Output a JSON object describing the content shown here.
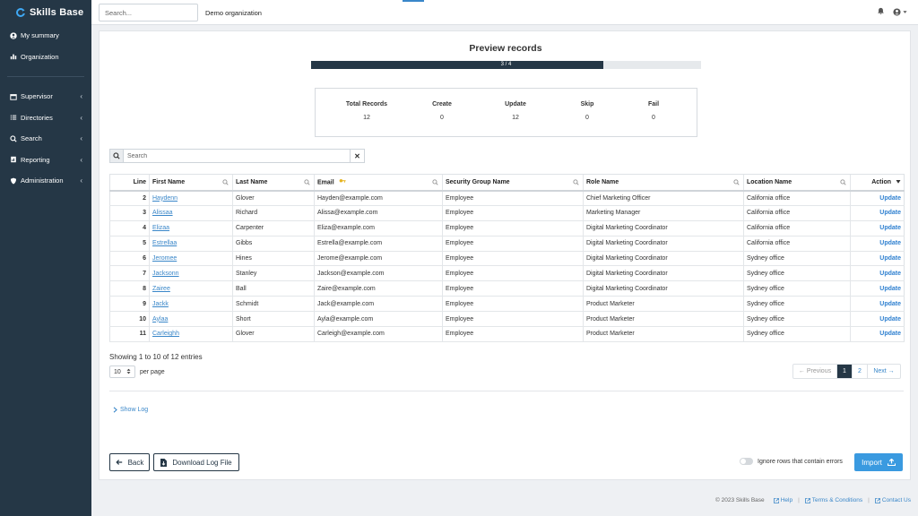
{
  "app": {
    "name": "Skills Base"
  },
  "sidebar": {
    "items": [
      {
        "label": "My summary",
        "icon": "user-circle-icon",
        "chevron": false
      },
      {
        "label": "Organization",
        "icon": "bar-chart-icon",
        "chevron": false
      }
    ],
    "sections": [
      {
        "label": "Supervisor",
        "icon": "calendar-icon"
      },
      {
        "label": "Directories",
        "icon": "list-icon"
      },
      {
        "label": "Search",
        "icon": "search-icon"
      },
      {
        "label": "Reporting",
        "icon": "report-icon"
      },
      {
        "label": "Administration",
        "icon": "shield-icon"
      }
    ]
  },
  "topbar": {
    "search_placeholder": "Search...",
    "org": "Demo organization"
  },
  "preview": {
    "title": "Preview records",
    "progress": {
      "text": "3 / 4",
      "fraction": 0.75
    },
    "stats": [
      {
        "label": "Total Records",
        "value": "12"
      },
      {
        "label": "Create",
        "value": "0"
      },
      {
        "label": "Update",
        "value": "12"
      },
      {
        "label": "Skip",
        "value": "0"
      },
      {
        "label": "Fail",
        "value": "0"
      }
    ]
  },
  "table": {
    "search_placeholder": "Search",
    "clear_label": "✕",
    "columns": [
      "Line",
      "First Name",
      "Last Name",
      "Email",
      "Security Group Name",
      "Role Name",
      "Location Name",
      "Action"
    ],
    "rows": [
      [
        "2",
        "Haydenn",
        "Glover",
        "Hayden@example.com",
        "Employee",
        "Chief Marketing Officer",
        "California office",
        "Update"
      ],
      [
        "3",
        "Alissaa",
        "Richard",
        "Alissa@example.com",
        "Employee",
        "Marketing Manager",
        "California office",
        "Update"
      ],
      [
        "4",
        "Elizaa",
        "Carpenter",
        "Eliza@example.com",
        "Employee",
        "Digital Marketing Coordinator",
        "California office",
        "Update"
      ],
      [
        "5",
        "Estrellaa",
        "Gibbs",
        "Estrella@example.com",
        "Employee",
        "Digital Marketing Coordinator",
        "California office",
        "Update"
      ],
      [
        "6",
        "Jeromee",
        "Hines",
        "Jerome@example.com",
        "Employee",
        "Digital Marketing Coordinator",
        "Sydney office",
        "Update"
      ],
      [
        "7",
        "Jacksonn",
        "Stanley",
        "Jackson@example.com",
        "Employee",
        "Digital Marketing Coordinator",
        "Sydney office",
        "Update"
      ],
      [
        "8",
        "Zairee",
        "Ball",
        "Zaire@example.com",
        "Employee",
        "Digital Marketing Coordinator",
        "Sydney office",
        "Update"
      ],
      [
        "9",
        "Jackk",
        "Schmidt",
        "Jack@example.com",
        "Employee",
        "Product Marketer",
        "Sydney office",
        "Update"
      ],
      [
        "10",
        "Aylaa",
        "Short",
        "Ayla@example.com",
        "Employee",
        "Product Marketer",
        "Sydney office",
        "Update"
      ],
      [
        "11",
        "Carleighh",
        "Glover",
        "Carleigh@example.com",
        "Employee",
        "Product Marketer",
        "Sydney office",
        "Update"
      ]
    ],
    "showing": "Showing 1 to 10 of 12 entries",
    "per_page_value": "10",
    "per_page_label": "per page",
    "pager": {
      "prev": "← Previous",
      "pages": [
        "1",
        "2"
      ],
      "next": "Next →",
      "current": "1"
    }
  },
  "show_log": "Show Log",
  "actions": {
    "back": "Back",
    "download": "Download Log File",
    "ignore_label": "Ignore rows that contain errors",
    "import": "Import"
  },
  "footer": {
    "copyright": "© 2023 Skills Base",
    "help": "Help",
    "terms": "Terms & Conditions",
    "contact": "Contact Us",
    "sep": "|"
  },
  "colors": {
    "sidebar": "#253746",
    "accent": "#3a87c9",
    "import": "#3a9ae0"
  }
}
